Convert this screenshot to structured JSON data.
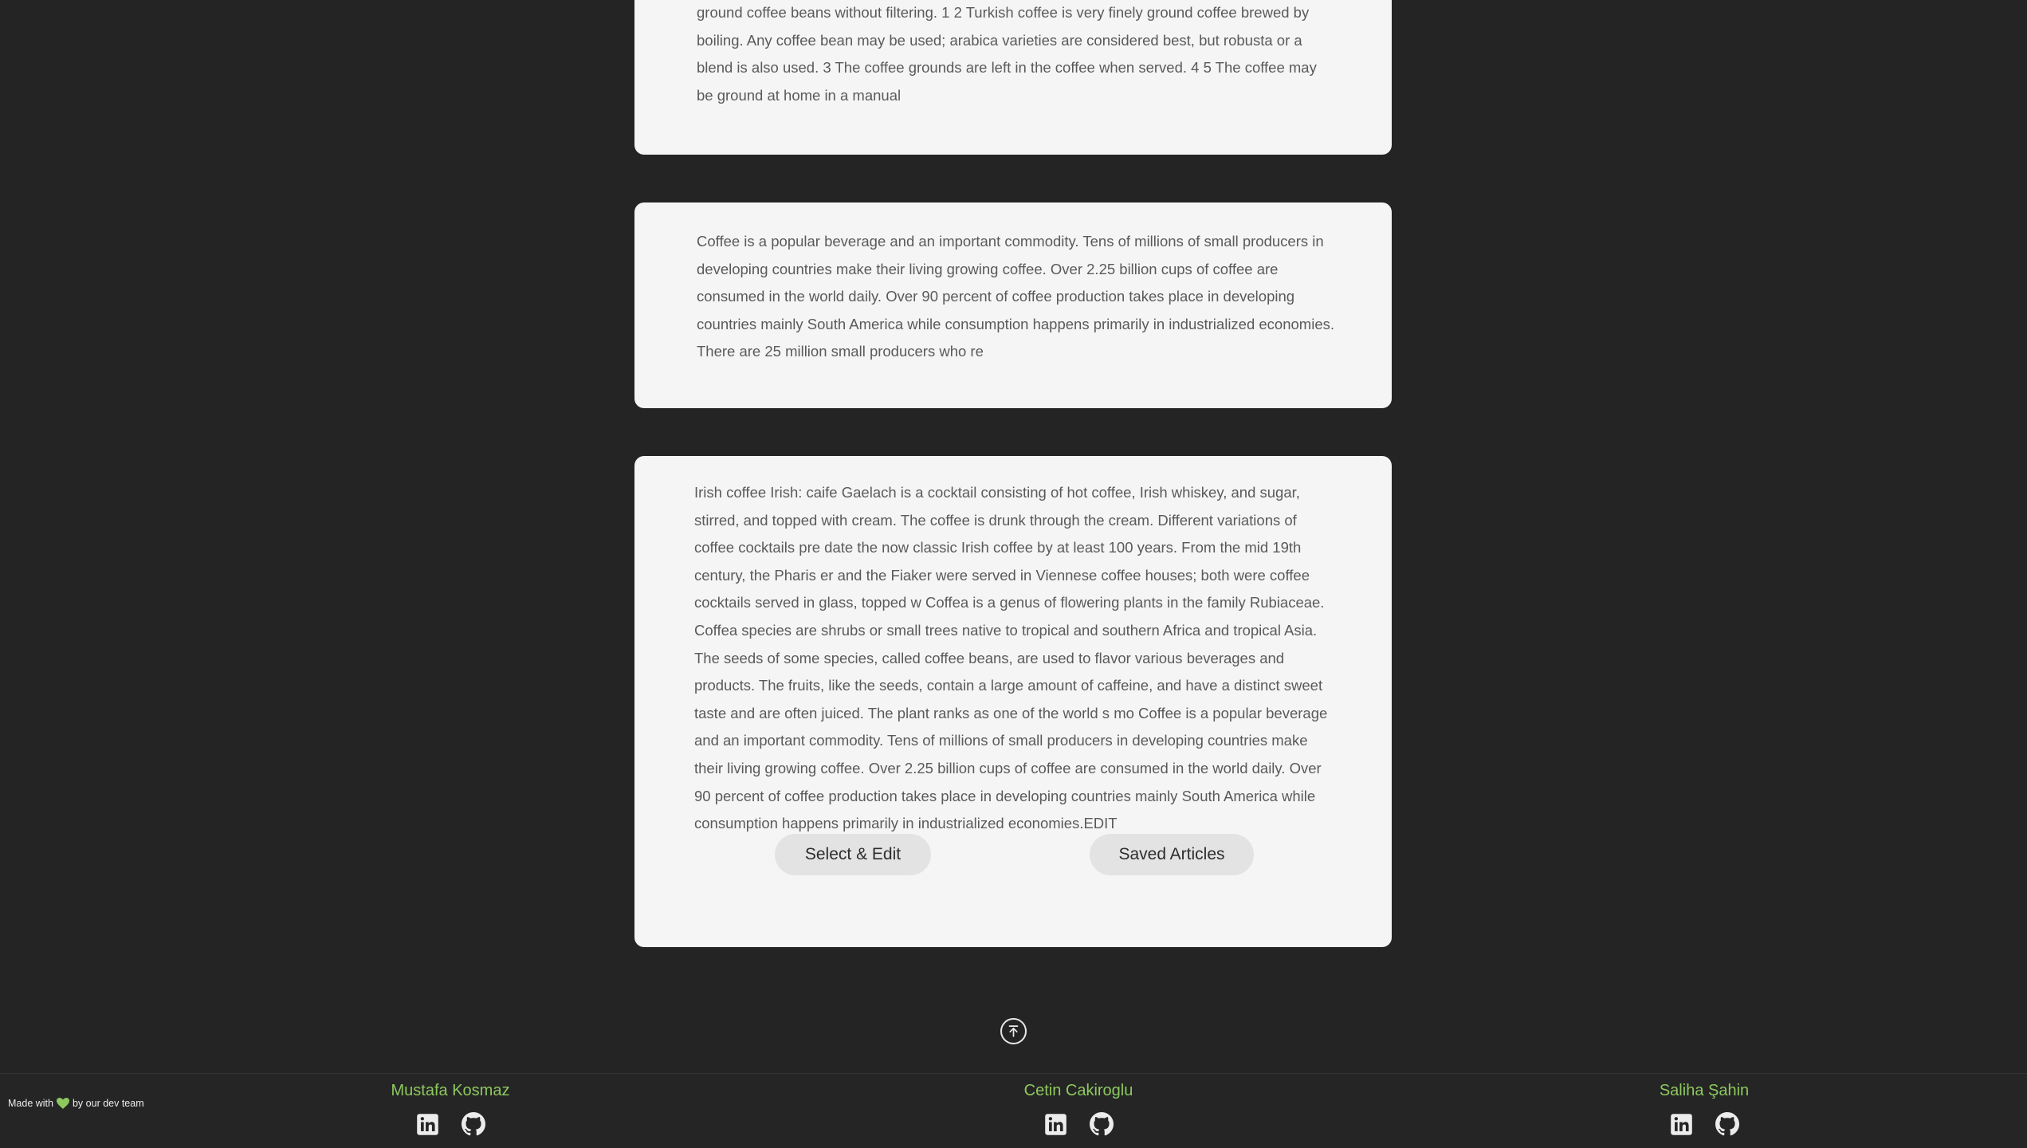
{
  "articles": [
    {
      "text": "ground coffee beans without filtering. 1 2 Turkish coffee is very finely ground coffee brewed by boiling. Any coffee bean may be used; arabica varieties are considered best, but robusta or a blend is also used. 3 The coffee grounds are left in the coffee when served. 4 5 The coffee may be ground at home in a manual"
    },
    {
      "text": "Coffee is a popular beverage and an important commodity. Tens of millions of small producers in developing countries make their living growing coffee. Over 2.25 billion cups of coffee are consumed in the world daily. Over 90 percent of coffee production takes place in developing countries mainly South America while consumption happens primarily in industrialized economies. There are 25 million small producers who re"
    },
    {
      "text": "Irish coffee Irish: caife Gaelach is a cocktail consisting of hot coffee, Irish whiskey, and sugar, stirred, and topped with cream. The coffee is drunk through the cream. Different variations of coffee cocktails pre date the now classic Irish coffee by at least 100 years. From the mid 19th century, the Pharis er and the Fiaker were served in Viennese coffee houses; both were coffee cocktails served in glass, topped w Coffea is a genus of flowering plants in the family Rubiaceae. Coffea species are shrubs or small trees native to tropical and southern Africa and tropical Asia. The seeds of some species, called coffee beans, are used to flavor various beverages and products. The fruits, like the seeds, contain a large amount of caffeine, and have a distinct sweet taste and are often juiced. The plant ranks as one of the world s mo Coffee is a popular beverage and an important commodity. Tens of millions of small producers in developing countries make their living growing coffee. Over 2.25 billion cups of coffee are consumed in the world daily. Over 90 percent of coffee production takes place in developing countries mainly South America while consumption happens primarily in industrialized economies.EDIT"
    }
  ],
  "actions": {
    "select_edit_label": "Select & Edit",
    "saved_articles_label": "Saved Articles"
  },
  "scroll_top": {
    "icon": "arrow-up-to-line-icon"
  },
  "footer": {
    "made_with_prefix": "Made with",
    "made_with_suffix": "by our dev team",
    "heart_icon": "heart-icon",
    "heart_color": "#8dc85f",
    "name_color": "#8dc85f",
    "developers": [
      {
        "name": "Mustafa Kosmaz",
        "icons": [
          "linkedin-icon",
          "github-icon"
        ]
      },
      {
        "name": "Cetin Cakiroglu",
        "icons": [
          "linkedin-icon",
          "github-icon"
        ]
      },
      {
        "name": "Saliha Şahin",
        "icons": [
          "linkedin-icon",
          "github-icon"
        ]
      }
    ]
  },
  "colors": {
    "background": "#242424",
    "card": "#f5f5f5",
    "button": "#e3e3e3"
  }
}
